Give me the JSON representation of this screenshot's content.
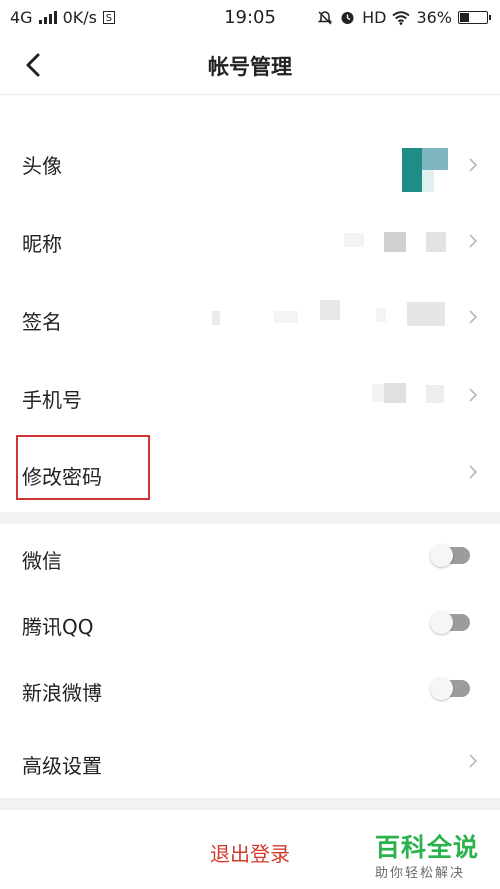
{
  "status_bar": {
    "network": "4G",
    "speed": "0K/s",
    "s_icon": "S",
    "time": "19:05",
    "hd": "HD",
    "battery": "36%"
  },
  "header": {
    "title": "帐号管理"
  },
  "account_rows": [
    {
      "label": "头像"
    },
    {
      "label": "昵称"
    },
    {
      "label": "签名"
    },
    {
      "label": "手机号"
    },
    {
      "label": "修改密码"
    }
  ],
  "bind_rows": [
    {
      "label": "微信",
      "enabled": false
    },
    {
      "label": "腾讯QQ",
      "enabled": false
    },
    {
      "label": "新浪微博",
      "enabled": false
    }
  ],
  "advanced": {
    "label": "高级设置"
  },
  "logout_label": "退出登录",
  "watermark": {
    "title": "百科全说",
    "subtitle": "助你轻松解决"
  },
  "colors": {
    "accent_red": "#d23c2c",
    "highlight_red": "#d23333",
    "brand_green": "#2bb24c",
    "toggle_off": "#9c9c9c"
  }
}
